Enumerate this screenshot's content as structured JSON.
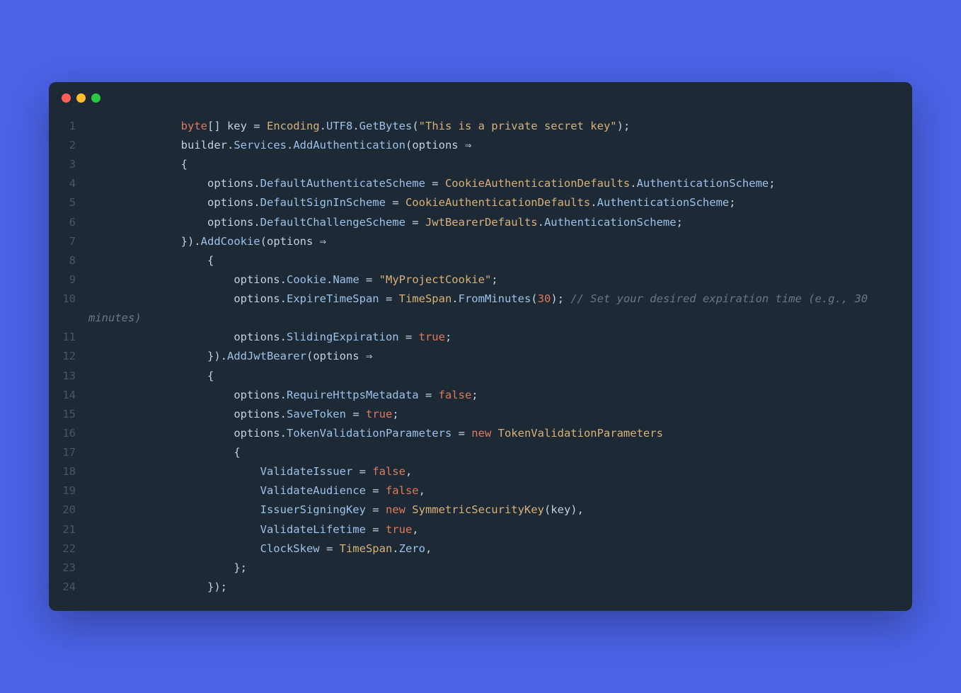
{
  "window": {
    "controls": [
      "close",
      "minimize",
      "maximize"
    ]
  },
  "code": {
    "lines": [
      {
        "n": "1",
        "tokens": [
          {
            "t": "              ",
            "c": "op"
          },
          {
            "t": "byte",
            "c": "kw"
          },
          {
            "t": "[] key = ",
            "c": "op"
          },
          {
            "t": "Encoding",
            "c": "cls"
          },
          {
            "t": ".",
            "c": "op"
          },
          {
            "t": "UTF8",
            "c": "mem"
          },
          {
            "t": ".",
            "c": "op"
          },
          {
            "t": "GetBytes",
            "c": "fn"
          },
          {
            "t": "(",
            "c": "op"
          },
          {
            "t": "\"This is a private secret key\"",
            "c": "str"
          },
          {
            "t": ");",
            "c": "op"
          }
        ]
      },
      {
        "n": "2",
        "tokens": [
          {
            "t": "              ",
            "c": "op"
          },
          {
            "t": "builder",
            "c": "id"
          },
          {
            "t": ".",
            "c": "op"
          },
          {
            "t": "Services",
            "c": "mem"
          },
          {
            "t": ".",
            "c": "op"
          },
          {
            "t": "AddAuthentication",
            "c": "fn"
          },
          {
            "t": "(",
            "c": "op"
          },
          {
            "t": "options",
            "c": "id"
          },
          {
            "t": " ⇒",
            "c": "op"
          }
        ]
      },
      {
        "n": "3",
        "tokens": [
          {
            "t": "              {",
            "c": "op"
          }
        ]
      },
      {
        "n": "4",
        "tokens": [
          {
            "t": "                  ",
            "c": "op"
          },
          {
            "t": "options",
            "c": "id"
          },
          {
            "t": ".",
            "c": "op"
          },
          {
            "t": "DefaultAuthenticateScheme",
            "c": "mem"
          },
          {
            "t": " = ",
            "c": "op"
          },
          {
            "t": "CookieAuthenticationDefaults",
            "c": "cls"
          },
          {
            "t": ".",
            "c": "op"
          },
          {
            "t": "AuthenticationScheme",
            "c": "mem"
          },
          {
            "t": ";",
            "c": "op"
          }
        ]
      },
      {
        "n": "5",
        "tokens": [
          {
            "t": "                  ",
            "c": "op"
          },
          {
            "t": "options",
            "c": "id"
          },
          {
            "t": ".",
            "c": "op"
          },
          {
            "t": "DefaultSignInScheme",
            "c": "mem"
          },
          {
            "t": " = ",
            "c": "op"
          },
          {
            "t": "CookieAuthenticationDefaults",
            "c": "cls"
          },
          {
            "t": ".",
            "c": "op"
          },
          {
            "t": "AuthenticationScheme",
            "c": "mem"
          },
          {
            "t": ";",
            "c": "op"
          }
        ]
      },
      {
        "n": "6",
        "tokens": [
          {
            "t": "                  ",
            "c": "op"
          },
          {
            "t": "options",
            "c": "id"
          },
          {
            "t": ".",
            "c": "op"
          },
          {
            "t": "DefaultChallengeScheme",
            "c": "mem"
          },
          {
            "t": " = ",
            "c": "op"
          },
          {
            "t": "JwtBearerDefaults",
            "c": "cls"
          },
          {
            "t": ".",
            "c": "op"
          },
          {
            "t": "AuthenticationScheme",
            "c": "mem"
          },
          {
            "t": ";",
            "c": "op"
          }
        ]
      },
      {
        "n": "7",
        "tokens": [
          {
            "t": "              }).",
            "c": "op"
          },
          {
            "t": "AddCookie",
            "c": "fn"
          },
          {
            "t": "(",
            "c": "op"
          },
          {
            "t": "options",
            "c": "id"
          },
          {
            "t": " ⇒",
            "c": "op"
          }
        ]
      },
      {
        "n": "8",
        "tokens": [
          {
            "t": "                  {",
            "c": "op"
          }
        ]
      },
      {
        "n": "9",
        "tokens": [
          {
            "t": "                      ",
            "c": "op"
          },
          {
            "t": "options",
            "c": "id"
          },
          {
            "t": ".",
            "c": "op"
          },
          {
            "t": "Cookie",
            "c": "mem"
          },
          {
            "t": ".",
            "c": "op"
          },
          {
            "t": "Name",
            "c": "mem"
          },
          {
            "t": " = ",
            "c": "op"
          },
          {
            "t": "\"MyProjectCookie\"",
            "c": "str"
          },
          {
            "t": ";",
            "c": "op"
          }
        ]
      },
      {
        "n": "10",
        "tokens": [
          {
            "t": "                      ",
            "c": "op"
          },
          {
            "t": "options",
            "c": "id"
          },
          {
            "t": ".",
            "c": "op"
          },
          {
            "t": "ExpireTimeSpan",
            "c": "mem"
          },
          {
            "t": " = ",
            "c": "op"
          },
          {
            "t": "TimeSpan",
            "c": "cls"
          },
          {
            "t": ".",
            "c": "op"
          },
          {
            "t": "FromMinutes",
            "c": "fn"
          },
          {
            "t": "(",
            "c": "op"
          },
          {
            "t": "30",
            "c": "num"
          },
          {
            "t": "); ",
            "c": "op"
          },
          {
            "t": "// Set your desired expiration time (e.g., 30 minutes)",
            "c": "cmt"
          }
        ]
      },
      {
        "n": "11",
        "tokens": [
          {
            "t": "                      ",
            "c": "op"
          },
          {
            "t": "options",
            "c": "id"
          },
          {
            "t": ".",
            "c": "op"
          },
          {
            "t": "SlidingExpiration",
            "c": "mem"
          },
          {
            "t": " = ",
            "c": "op"
          },
          {
            "t": "true",
            "c": "kw"
          },
          {
            "t": ";",
            "c": "op"
          }
        ]
      },
      {
        "n": "12",
        "tokens": [
          {
            "t": "                  }).",
            "c": "op"
          },
          {
            "t": "AddJwtBearer",
            "c": "fn"
          },
          {
            "t": "(",
            "c": "op"
          },
          {
            "t": "options",
            "c": "id"
          },
          {
            "t": " ⇒",
            "c": "op"
          }
        ]
      },
      {
        "n": "13",
        "tokens": [
          {
            "t": "                  {",
            "c": "op"
          }
        ]
      },
      {
        "n": "14",
        "tokens": [
          {
            "t": "                      ",
            "c": "op"
          },
          {
            "t": "options",
            "c": "id"
          },
          {
            "t": ".",
            "c": "op"
          },
          {
            "t": "RequireHttpsMetadata",
            "c": "mem"
          },
          {
            "t": " = ",
            "c": "op"
          },
          {
            "t": "false",
            "c": "kw"
          },
          {
            "t": ";",
            "c": "op"
          }
        ]
      },
      {
        "n": "15",
        "tokens": [
          {
            "t": "                      ",
            "c": "op"
          },
          {
            "t": "options",
            "c": "id"
          },
          {
            "t": ".",
            "c": "op"
          },
          {
            "t": "SaveToken",
            "c": "mem"
          },
          {
            "t": " = ",
            "c": "op"
          },
          {
            "t": "true",
            "c": "kw"
          },
          {
            "t": ";",
            "c": "op"
          }
        ]
      },
      {
        "n": "16",
        "tokens": [
          {
            "t": "                      ",
            "c": "op"
          },
          {
            "t": "options",
            "c": "id"
          },
          {
            "t": ".",
            "c": "op"
          },
          {
            "t": "TokenValidationParameters",
            "c": "mem"
          },
          {
            "t": " = ",
            "c": "op"
          },
          {
            "t": "new",
            "c": "kw"
          },
          {
            "t": " ",
            "c": "op"
          },
          {
            "t": "TokenValidationParameters",
            "c": "cls"
          }
        ]
      },
      {
        "n": "17",
        "tokens": [
          {
            "t": "                      {",
            "c": "op"
          }
        ]
      },
      {
        "n": "18",
        "tokens": [
          {
            "t": "                          ",
            "c": "op"
          },
          {
            "t": "ValidateIssuer",
            "c": "prop"
          },
          {
            "t": " = ",
            "c": "op"
          },
          {
            "t": "false",
            "c": "kw"
          },
          {
            "t": ",",
            "c": "op"
          }
        ]
      },
      {
        "n": "19",
        "tokens": [
          {
            "t": "                          ",
            "c": "op"
          },
          {
            "t": "ValidateAudience",
            "c": "prop"
          },
          {
            "t": " = ",
            "c": "op"
          },
          {
            "t": "false",
            "c": "kw"
          },
          {
            "t": ",",
            "c": "op"
          }
        ]
      },
      {
        "n": "20",
        "tokens": [
          {
            "t": "                          ",
            "c": "op"
          },
          {
            "t": "IssuerSigningKey",
            "c": "prop"
          },
          {
            "t": " = ",
            "c": "op"
          },
          {
            "t": "new",
            "c": "kw"
          },
          {
            "t": " ",
            "c": "op"
          },
          {
            "t": "SymmetricSecurityKey",
            "c": "cls"
          },
          {
            "t": "(",
            "c": "op"
          },
          {
            "t": "key",
            "c": "id"
          },
          {
            "t": "),",
            "c": "op"
          }
        ]
      },
      {
        "n": "21",
        "tokens": [
          {
            "t": "                          ",
            "c": "op"
          },
          {
            "t": "ValidateLifetime",
            "c": "prop"
          },
          {
            "t": " = ",
            "c": "op"
          },
          {
            "t": "true",
            "c": "kw"
          },
          {
            "t": ",",
            "c": "op"
          }
        ]
      },
      {
        "n": "22",
        "tokens": [
          {
            "t": "                          ",
            "c": "op"
          },
          {
            "t": "ClockSkew",
            "c": "prop"
          },
          {
            "t": " = ",
            "c": "op"
          },
          {
            "t": "TimeSpan",
            "c": "cls"
          },
          {
            "t": ".",
            "c": "op"
          },
          {
            "t": "Zero",
            "c": "mem"
          },
          {
            "t": ",",
            "c": "op"
          }
        ]
      },
      {
        "n": "23",
        "tokens": [
          {
            "t": "                      };",
            "c": "op"
          }
        ]
      },
      {
        "n": "24",
        "tokens": [
          {
            "t": "                  });",
            "c": "op"
          }
        ]
      }
    ]
  }
}
